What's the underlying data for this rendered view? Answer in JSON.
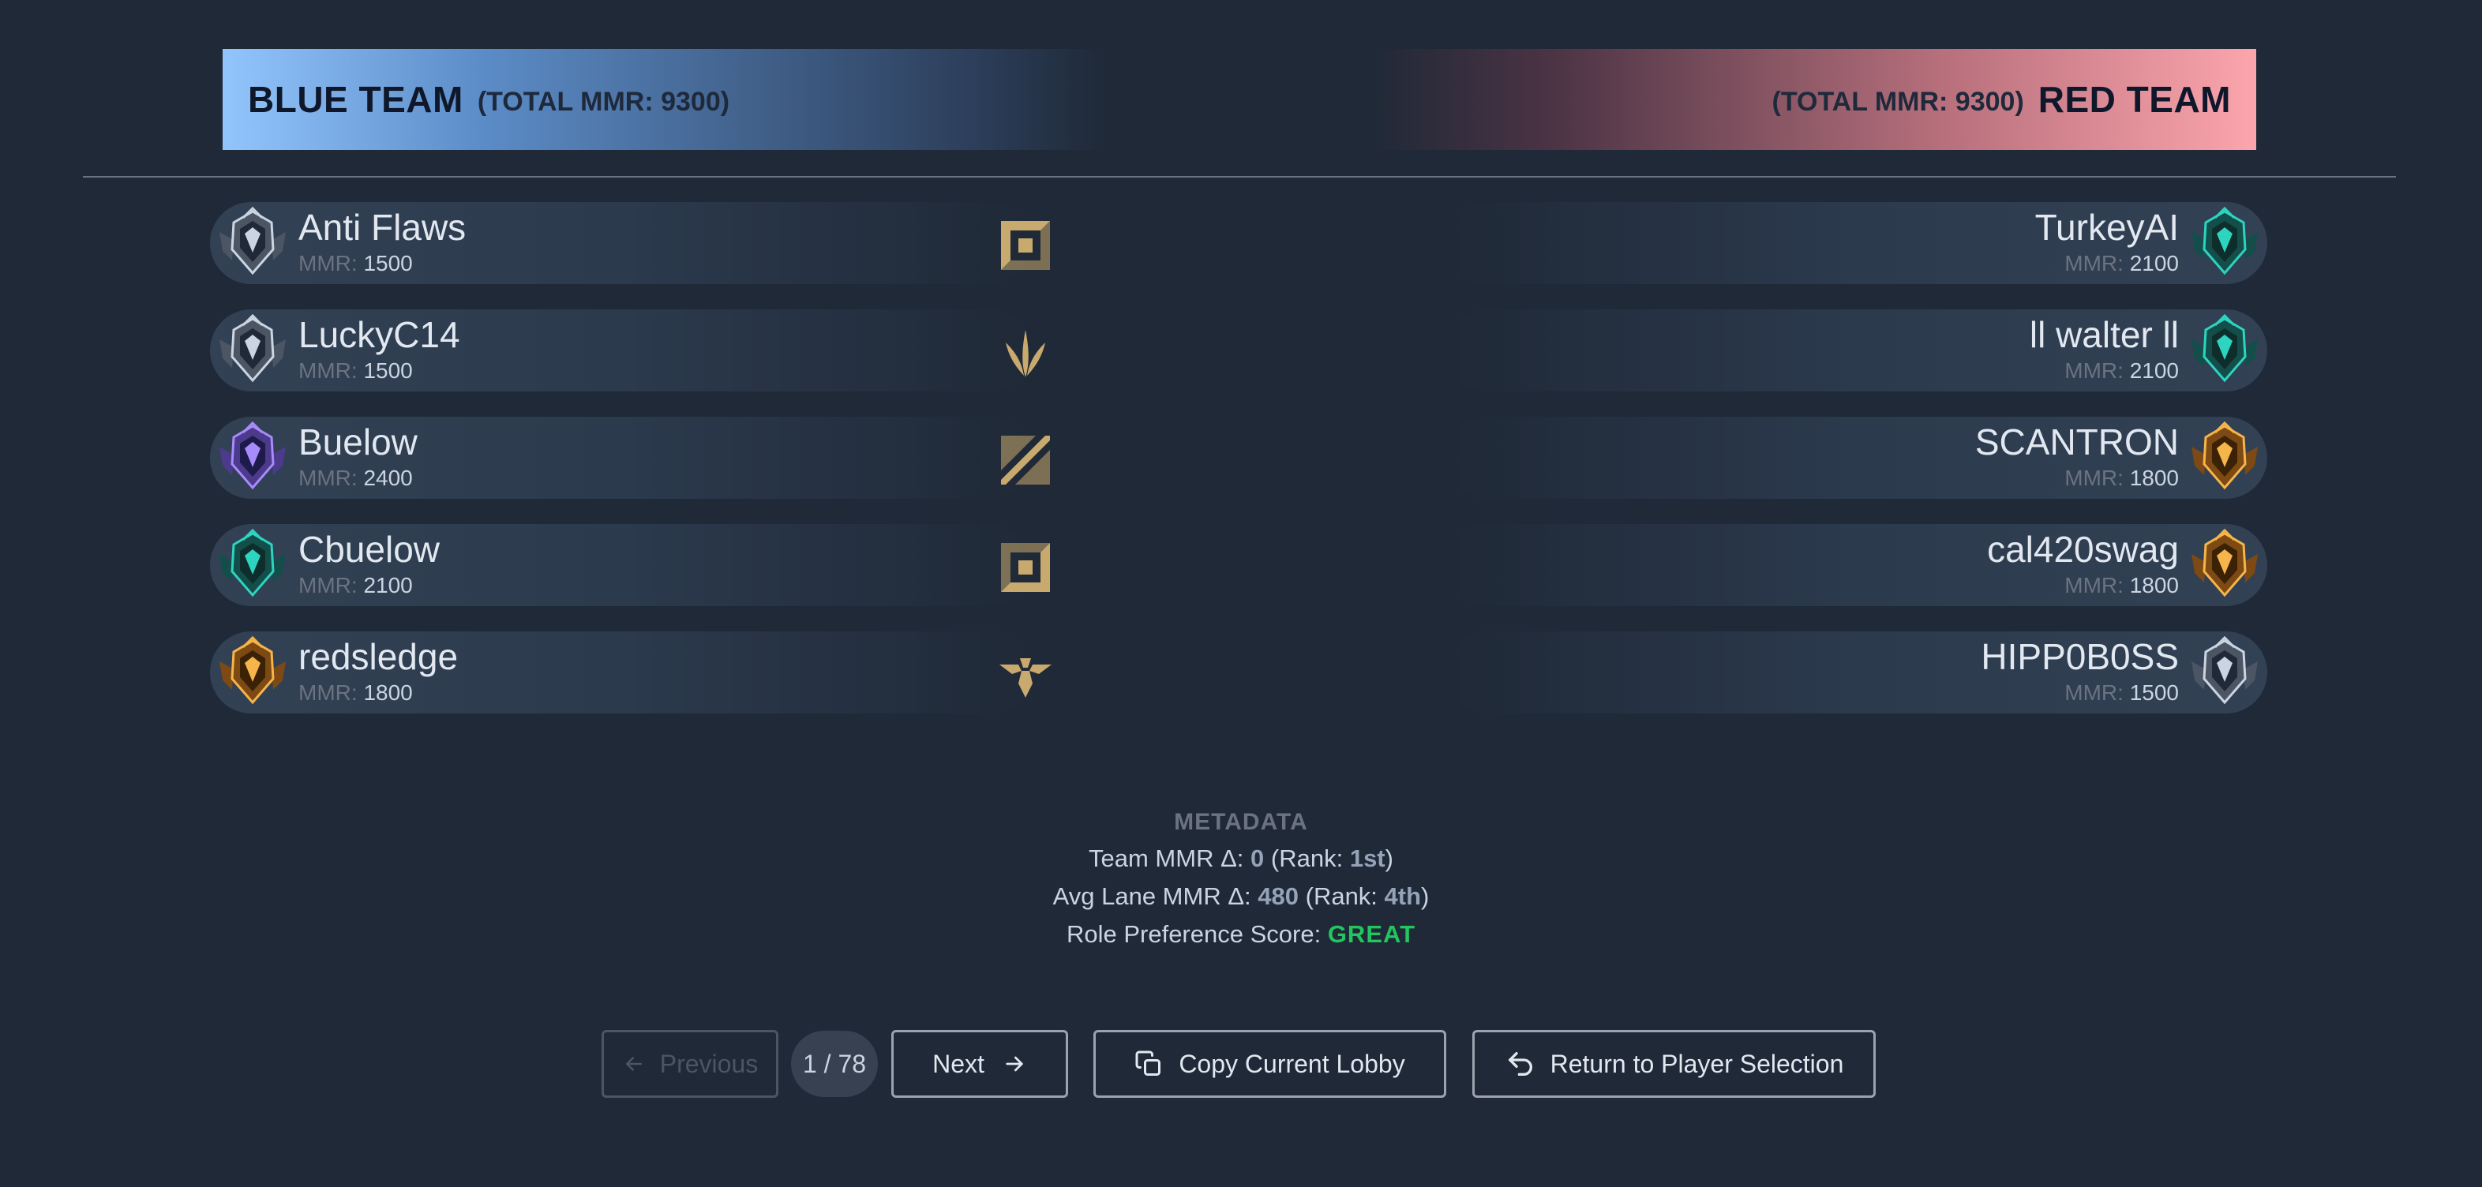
{
  "blue_team": {
    "name": "BLUE TEAM",
    "total_mmr": "(TOTAL MMR: 9300)",
    "color": "#93c5fd",
    "players": [
      {
        "name": "Anti Flaws",
        "mmr_label": "MMR:",
        "mmr": "1500",
        "rank_icon": "silver-rank-icon"
      },
      {
        "name": "LuckyC14",
        "mmr_label": "MMR:",
        "mmr": "1500",
        "rank_icon": "silver-rank-icon"
      },
      {
        "name": "Buelow",
        "mmr_label": "MMR:",
        "mmr": "2400",
        "rank_icon": "diamond-rank-icon"
      },
      {
        "name": "Cbuelow",
        "mmr_label": "MMR:",
        "mmr": "2100",
        "rank_icon": "emerald-rank-icon"
      },
      {
        "name": "redsledge",
        "mmr_label": "MMR:",
        "mmr": "1800",
        "rank_icon": "gold-rank-icon"
      }
    ]
  },
  "red_team": {
    "name": "RED TEAM",
    "total_mmr": "(TOTAL MMR: 9300)",
    "color": "#fca5ad",
    "players": [
      {
        "name": "TurkeyAI",
        "mmr_label": "MMR:",
        "mmr": "2100",
        "rank_icon": "emerald-rank-icon"
      },
      {
        "name": "ll walter ll",
        "mmr_label": "MMR:",
        "mmr": "2100",
        "rank_icon": "emerald-rank-icon"
      },
      {
        "name": "SCANTRON",
        "mmr_label": "MMR:",
        "mmr": "1800",
        "rank_icon": "gold-rank-icon"
      },
      {
        "name": "cal420swag",
        "mmr_label": "MMR:",
        "mmr": "1800",
        "rank_icon": "gold-rank-icon"
      },
      {
        "name": "HIPP0B0SS",
        "mmr_label": "MMR:",
        "mmr": "1500",
        "rank_icon": "silver-rank-icon"
      }
    ]
  },
  "roles": [
    "top-role-icon",
    "jungle-role-icon",
    "mid-role-icon",
    "bottom-role-icon",
    "support-role-icon"
  ],
  "metadata": {
    "title": "METADATA",
    "team_mmr_label": "Team MMR Δ:",
    "team_mmr_value": "0",
    "team_rank_label": "Rank:",
    "team_rank_value": "1st",
    "avg_lane_label": "Avg Lane MMR Δ:",
    "avg_lane_value": "480",
    "avg_lane_rank_label": "Rank:",
    "avg_lane_rank_value": "4th",
    "role_pref_label": "Role Preference Score:",
    "role_pref_value": "GREAT",
    "role_pref_color": "#22c55e"
  },
  "pagination": {
    "previous_label": "Previous",
    "next_label": "Next",
    "counter": "1 / 78"
  },
  "actions": {
    "copy_label": "Copy Current Lobby",
    "return_label": "Return to Player Selection"
  },
  "colors": {
    "background": "#1f2937",
    "role_icon": "#c8aa6e",
    "muted": "#6b7280"
  }
}
